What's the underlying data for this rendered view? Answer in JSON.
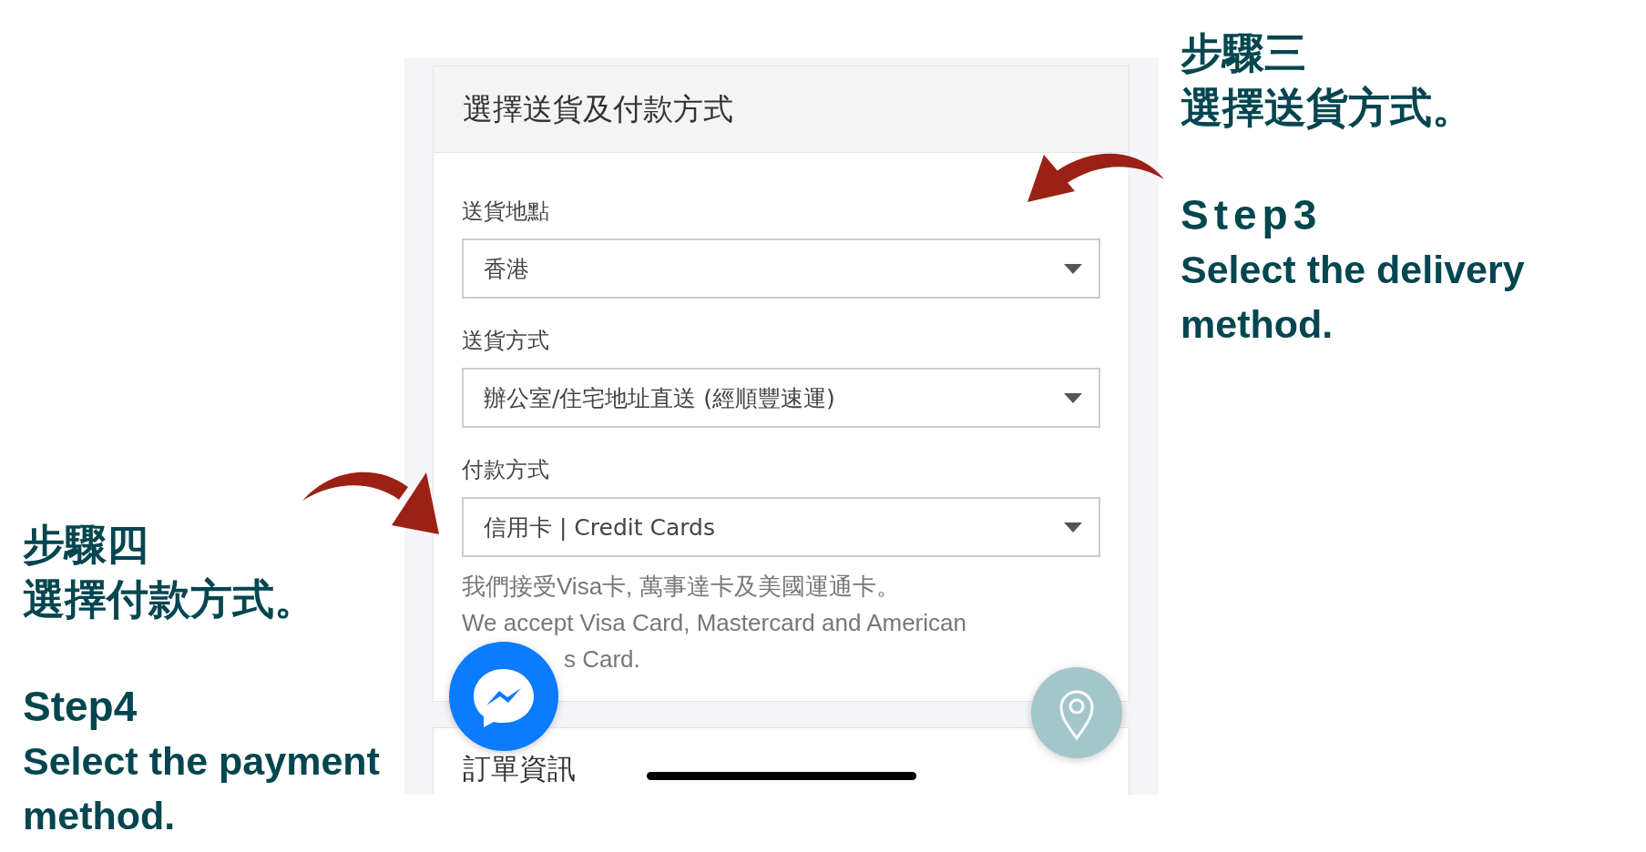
{
  "checkout": {
    "title": "選擇送貨及付款方式",
    "fields": [
      {
        "label": "送貨地點",
        "value": "香港"
      },
      {
        "label": "送貨方式",
        "value": "辦公室/住宅地址直送 (經順豐速運)"
      },
      {
        "label": "付款方式",
        "value": "信用卡 | Credit Cards"
      }
    ],
    "help_lines": [
      {
        "kind": "full",
        "text": "我們接受Visa卡, 萬事達卡及美國運通卡。"
      },
      {
        "kind": "full",
        "text": "We accept Visa Card, Mastercard and American"
      },
      {
        "kind": "covered",
        "text": "s Card."
      }
    ]
  },
  "next_section": {
    "title": "訂單資訊"
  },
  "right_note": {
    "heading": "步驟三",
    "instruction": "選擇送貨方式。",
    "step": "Step3",
    "description": "Select the delivery method."
  },
  "left_note": {
    "heading": "步驟四",
    "instruction": "選擇付款方式。",
    "step": "Step4",
    "description": "Select the payment method."
  }
}
